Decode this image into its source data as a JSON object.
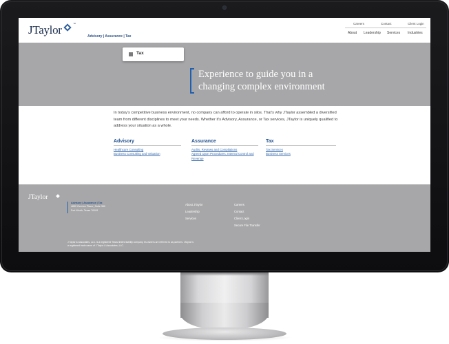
{
  "header": {
    "logo_text": "JTaylor",
    "logo_tm": "™",
    "tagline": "Advisory | Assurance | Tax",
    "utility_nav": [
      "Careers",
      "Contact",
      "Client Login"
    ],
    "main_nav": [
      "About",
      "Leadership",
      "Services",
      "Industries"
    ]
  },
  "hero": {
    "tab_label": "Tax",
    "headline_line1": "Experience to guide you in a",
    "headline_line2": "changing complex environment"
  },
  "intro": {
    "text": "In today's competitive business environment, no company can afford to operate in silos. That's why JTaylor assembled a diversified team from different disciplines to meet your needs. Whether it's Advisory, Assurance, or Tax services, JTaylor is uniquely qualified to address your situation as a whole."
  },
  "services": {
    "advisory": {
      "title": "Advisory",
      "links": [
        "Healthcare Consulting",
        "Business Consulting and Valuation"
      ]
    },
    "assurance": {
      "title": "Assurance",
      "links": [
        "Audits, Reviews and Compilations",
        "Agreed Upon Procedures, Internal Control and",
        "Revenue"
      ]
    },
    "tax": {
      "title": "Tax",
      "links": [
        "Tax Services",
        "Business Services"
      ]
    }
  },
  "footer": {
    "logo_text": "JTaylor",
    "address_lines": [
      "Advisory | Assurance | Tax",
      "4850 Overton Plaza | Suite 380",
      "Fort Worth, Texas 76109"
    ],
    "links_col1": [
      "About JTaylor",
      "Leadership",
      "Services"
    ],
    "links_col2": [
      "Careers",
      "Contact",
      "Client Login",
      "Secure File Transfer"
    ],
    "legal_line1": "J Taylor & Associates, LLC. is a registered Texas limited liability company. Its owners are referred to as partners. JTaylor is",
    "legal_line2": "a registered trade name of J Taylor & Associates, LLC."
  },
  "colors": {
    "brand_navy": "#1d2f4e",
    "accent_blue": "#1f5fae",
    "link_blue": "#3d6fae",
    "band_gray": "#a7a7a9",
    "bezel_black": "#121214"
  },
  "icons": {
    "camera": "camera-icon",
    "apple_logo": "apple-logo-icon",
    "tab_icon": "square-icon",
    "logo_mark": "cube-icon"
  }
}
